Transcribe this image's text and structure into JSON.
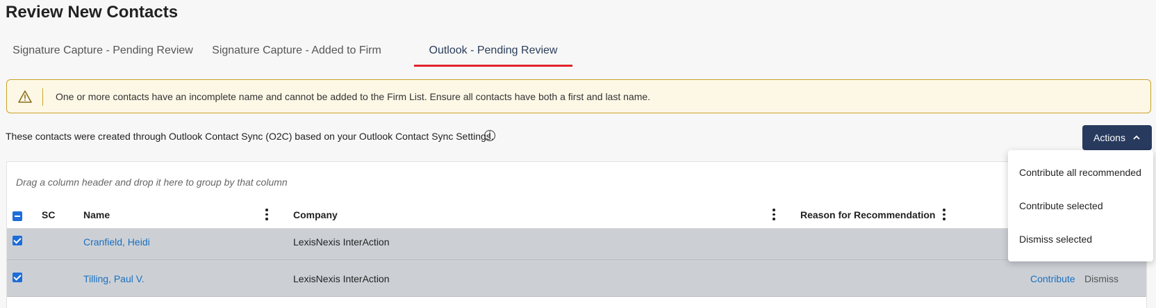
{
  "page": {
    "title": "Review New Contacts"
  },
  "tabs": [
    {
      "label": "Signature Capture - Pending Review"
    },
    {
      "label": "Signature Capture - Added to Firm"
    },
    {
      "label": "Outlook - Pending Review"
    }
  ],
  "warning": {
    "icon": "warning-triangle-icon",
    "message": "One or more contacts have an incomplete name and cannot be added to the Firm List. Ensure all contacts have both a first and last name."
  },
  "info": {
    "text": "These contacts were created through Outlook Contact Sync (O2C) based on your Outlook Contact Sync Settings.",
    "icon_glyph": "i"
  },
  "actions": {
    "label": "Actions",
    "menu": [
      "Contribute all recommended",
      "Contribute selected",
      "Dismiss selected"
    ]
  },
  "grid": {
    "group_hint": "Drag a column header and drop it here to group by that column",
    "columns": {
      "sc": "SC",
      "name": "Name",
      "company": "Company",
      "reason": "Reason for Recommendation"
    },
    "rows": [
      {
        "name": "Cranfield, Heidi",
        "company": "LexisNexis InterAction",
        "checked": true
      },
      {
        "name": "Tilling, Paul V.",
        "company": "LexisNexis InterAction",
        "checked": true,
        "contribute": "Contribute",
        "dismiss": "Dismiss"
      }
    ]
  },
  "colors": {
    "accent": "#283a5e",
    "tab_underline": "#e0242a",
    "link": "#1a6fc0",
    "warning_border": "#c9a227",
    "warning_bg": "#fdf8e6"
  }
}
